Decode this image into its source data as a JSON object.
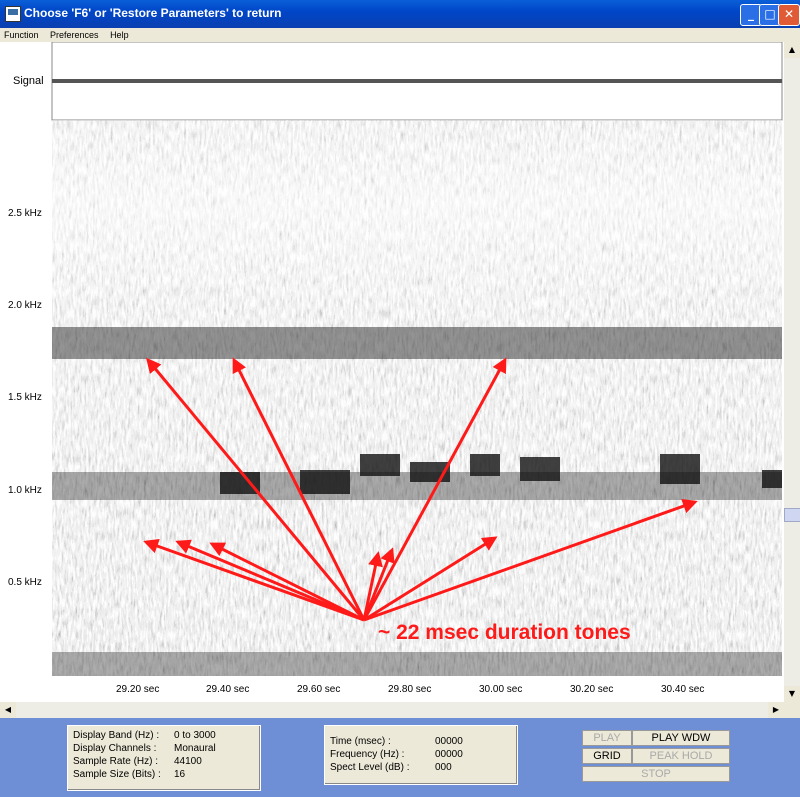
{
  "window": {
    "title": "Choose 'F6' or 'Restore Parameters' to return",
    "controls": {
      "minimize": "_",
      "maximize": "□",
      "close": "✕"
    }
  },
  "menu": [
    "Function",
    "Preferences",
    "Help"
  ],
  "signal_label": "Signal",
  "freq_labels": [
    "2.5 kHz",
    "2.0 kHz",
    "1.5 kHz",
    "1.0 kHz",
    "0.5 kHz"
  ],
  "time_labels": [
    "29.20 sec",
    "29.40 sec",
    "29.60 sec",
    "29.80 sec",
    "30.00 sec",
    "30.20 sec",
    "30.40 sec"
  ],
  "annotation": "~ 22 msec duration tones",
  "colors": {
    "annotation": "#ff1a1a",
    "titlebar": "#0a5fd8",
    "bottom_bar": "#6e8ed6"
  },
  "info_panel": {
    "rows": [
      {
        "label": "Display Band (Hz) :",
        "value": "0 to 3000"
      },
      {
        "label": "Display Channels :",
        "value": "Monaural"
      },
      {
        "label": "Sample Rate (Hz) :",
        "value": "44100"
      },
      {
        "label": "Sample Size (Bits) :",
        "value": "16"
      }
    ]
  },
  "cursor_panel": {
    "rows": [
      {
        "label": "Time (msec) :",
        "value": "00000"
      },
      {
        "label": "Frequency (Hz) :",
        "value": "00000"
      },
      {
        "label": "Spect Level (dB) :",
        "value": "000"
      }
    ]
  },
  "buttons": {
    "play": "PLAY",
    "play_wdw": "PLAY WDW",
    "grid": "GRID",
    "peak_hold": "PEAK HOLD",
    "stop": "STOP"
  },
  "icons": {
    "app": "app-icon",
    "scroll_up": "▲",
    "scroll_down": "▼",
    "scroll_left": "◀",
    "scroll_right": "▶"
  }
}
